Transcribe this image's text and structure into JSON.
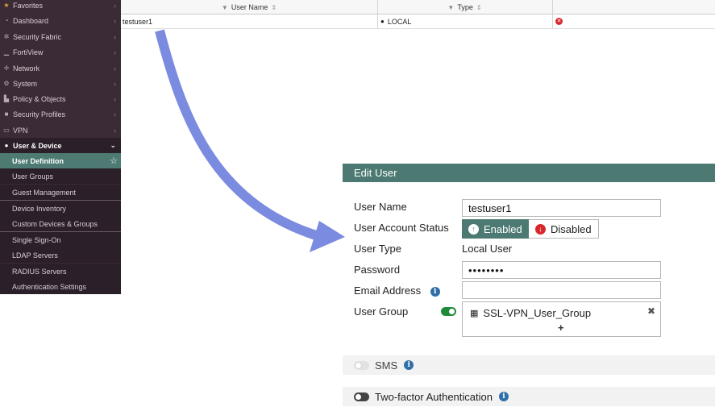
{
  "sidebar": {
    "items": [
      {
        "label": "Favorites",
        "icon": "star-icon"
      },
      {
        "label": "Dashboard",
        "icon": "dashboard-icon"
      },
      {
        "label": "Security Fabric",
        "icon": "fabric-icon"
      },
      {
        "label": "FortiView",
        "icon": "chart-icon"
      },
      {
        "label": "Network",
        "icon": "network-icon"
      },
      {
        "label": "System",
        "icon": "gear-icon"
      },
      {
        "label": "Policy & Objects",
        "icon": "policy-icon"
      },
      {
        "label": "Security Profiles",
        "icon": "lock-icon"
      },
      {
        "label": "VPN",
        "icon": "monitor-icon"
      },
      {
        "label": "User & Device",
        "icon": "user-icon"
      }
    ],
    "sub_items": [
      {
        "label": "User Definition"
      },
      {
        "label": "User Groups"
      },
      {
        "label": "Guest Management"
      },
      {
        "label": "Device Inventory"
      },
      {
        "label": "Custom Devices & Groups"
      },
      {
        "label": "Single Sign-On"
      },
      {
        "label": "LDAP Servers"
      },
      {
        "label": "RADIUS Servers"
      },
      {
        "label": "Authentication Settings"
      }
    ]
  },
  "table": {
    "columns": [
      "User Name",
      "Type"
    ],
    "rows": [
      {
        "name": "testuser1",
        "type": "LOCAL"
      }
    ]
  },
  "edit_user": {
    "title": "Edit User",
    "labels": {
      "user_name": "User Name",
      "account_status": "User Account Status",
      "user_type": "User Type",
      "password": "Password",
      "email": "Email Address",
      "user_group": "User Group"
    },
    "values": {
      "user_name": "testuser1",
      "status_enabled": "Enabled",
      "status_disabled": "Disabled",
      "user_type": "Local User",
      "password": "••••••••",
      "email": "",
      "group": "SSL-VPN_User_Group"
    },
    "sms_label": "SMS",
    "two_factor_label": "Two-factor Authentication"
  },
  "colors": {
    "accent": "#4c7a72",
    "sidebar_bg": "#3b2b37",
    "arrow": "#7a8be0",
    "delete_red": "#d7272d",
    "toggle_green": "#1e8a3a"
  }
}
